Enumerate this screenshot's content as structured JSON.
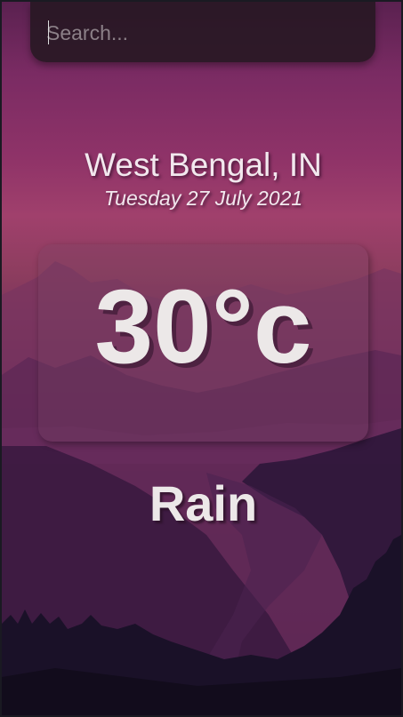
{
  "search": {
    "placeholder": "Search..."
  },
  "weather": {
    "location": "West Bengal, IN",
    "date": "Tuesday 27 July 2021",
    "temperature": "30°c",
    "condition": "Rain"
  },
  "colors": {
    "text": "#ece8e8",
    "search_bg": "#281824"
  }
}
